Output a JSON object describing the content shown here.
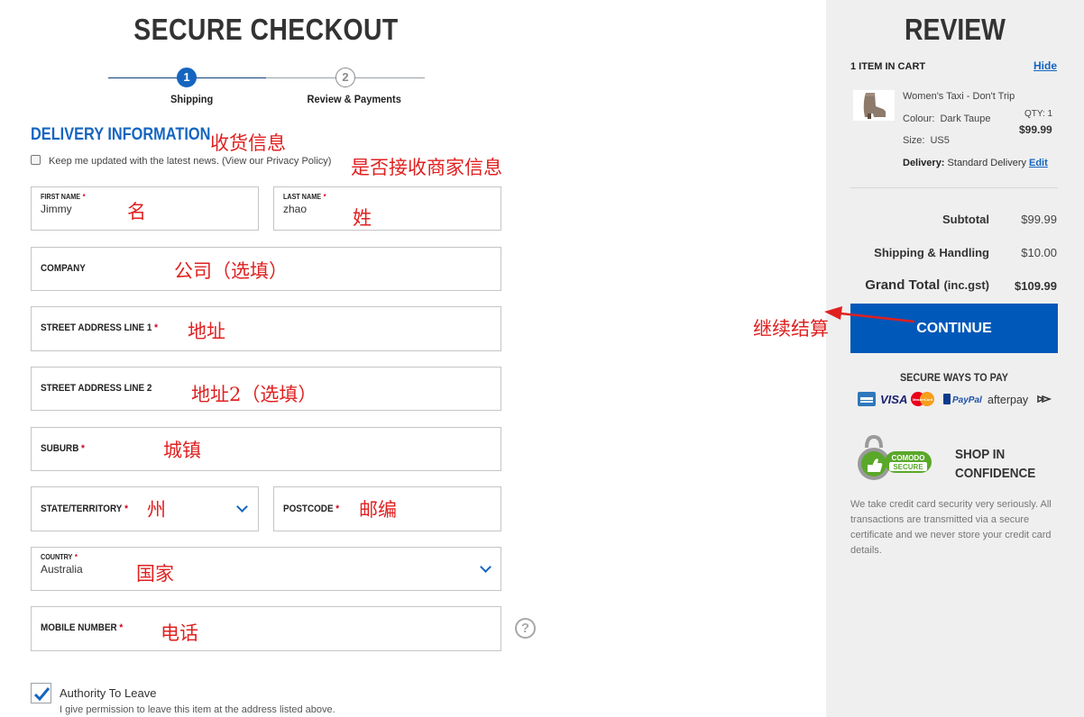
{
  "checkout": {
    "title": "SECURE CHECKOUT",
    "steps": [
      {
        "number": "1",
        "label": "Shipping"
      },
      {
        "number": "2",
        "label": "Review & Payments"
      }
    ],
    "section_title": "DELIVERY INFORMATION",
    "newsletter_label": "Keep me updated with the latest news. (View our Privacy Policy)",
    "fields": {
      "first_name": {
        "label": "FIRST NAME",
        "required": "*",
        "value": "Jimmy"
      },
      "last_name": {
        "label": "LAST NAME",
        "required": "*",
        "value": "zhao"
      },
      "company": {
        "label": "COMPANY"
      },
      "street1": {
        "label": "STREET ADDRESS LINE 1",
        "required": "*"
      },
      "street2": {
        "label": "STREET ADDRESS LINE 2"
      },
      "suburb": {
        "label": "SUBURB",
        "required": "*"
      },
      "state": {
        "label": "STATE/TERRITORY",
        "required": "*"
      },
      "postcode": {
        "label": "POSTCODE",
        "required": "*"
      },
      "country": {
        "label": "COUNTRY",
        "required": "*",
        "value": "Australia"
      },
      "mobile": {
        "label": "MOBILE NUMBER",
        "required": "*"
      }
    },
    "help_glyph": "?",
    "authority_to_leave": {
      "label": "Authority To Leave",
      "description": "I give permission to leave this item at the address listed above."
    }
  },
  "annotations": {
    "delivery_info": "收货信息",
    "newsletter": "是否接收商家信息",
    "first_name": "名",
    "last_name": "姓",
    "company": "公司（选填）",
    "street1": "地址",
    "street2": "地址2（选填）",
    "suburb": "城镇",
    "state": "州",
    "postcode": "邮编",
    "country": "国家",
    "mobile": "电话",
    "continue": "继续结算"
  },
  "review": {
    "title": "REVIEW",
    "items_count": "1 ITEM IN CART",
    "hide_label": "Hide",
    "item": {
      "name": "Women's Taxi - Don't Trip",
      "colour_label": "Colour:",
      "colour_value": "Dark Taupe",
      "size_label": "Size:",
      "size_value": "US5",
      "qty": "QTY: 1",
      "price": "$99.99"
    },
    "delivery_label": "Delivery:",
    "delivery_value": "Standard Delivery",
    "edit_label": "Edit",
    "totals": {
      "subtotal_label": "Subtotal",
      "subtotal_value": "$99.99",
      "shipping_label": "Shipping & Handling",
      "shipping_value": "$10.00",
      "grand_label": "Grand Total",
      "grand_suffix": "(inc.gst)",
      "grand_value": "$109.99"
    },
    "continue_label": "CONTINUE",
    "secure_ways_label": "SECURE WAYS TO PAY",
    "payment_methods": [
      "VISA",
      "MasterCard",
      "PayPal",
      "afterpay"
    ],
    "comodo_top": "COMODO",
    "comodo_bottom": "SECURE",
    "shop_line1": "SHOP IN",
    "shop_line2": "CONFIDENCE",
    "security_text": "We take credit card security very seriously. All transactions are transmitted via a secure certificate and we never store your credit card details."
  },
  "colors": {
    "accent": "#1565c0",
    "button": "#0058b9",
    "annotation": "#e02020",
    "panel_bg": "#efefef"
  }
}
